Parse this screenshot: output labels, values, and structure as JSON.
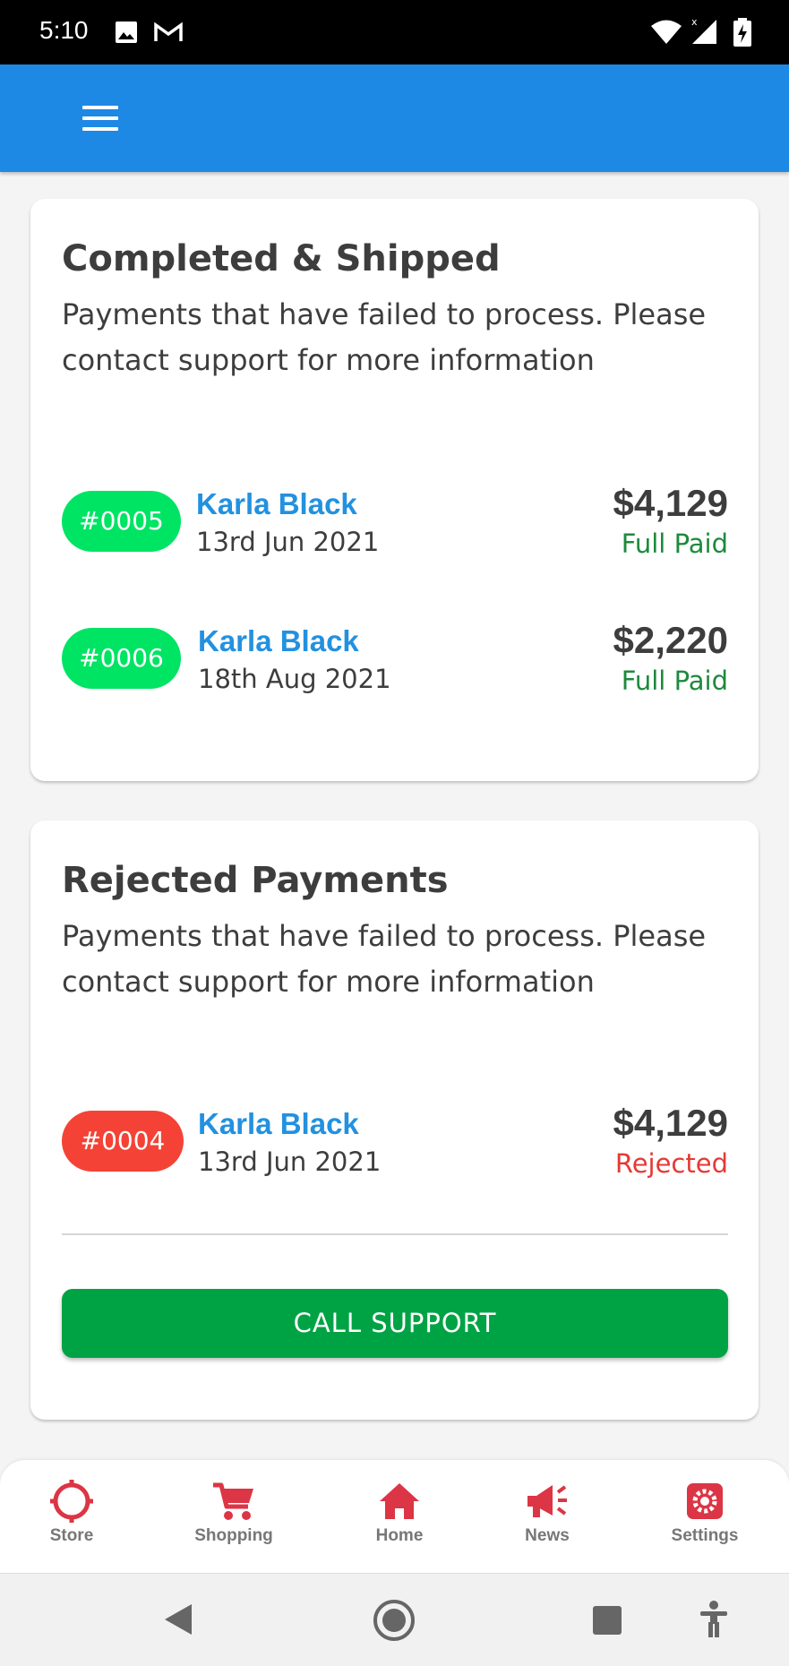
{
  "status_bar": {
    "time": "5:10",
    "left_icons": [
      "image-icon",
      "gmail-icon"
    ],
    "right_icons": [
      "wifi-icon",
      "signal-icon",
      "battery-charging-icon"
    ]
  },
  "app_bar": {
    "menu_icon": "hamburger-menu-icon",
    "color": "#1e88e5"
  },
  "sections": [
    {
      "title": "Completed & Shipped",
      "description": "Payments that have failed to process. Please contact support for more information",
      "orders": [
        {
          "id": "#0005",
          "customer": "Karla Black",
          "date": "13rd Jun 2021",
          "amount": "$4,129",
          "status": "Full Paid"
        },
        {
          "id": "#0006",
          "customer": "Karla Black",
          "date": "18th Aug 2021",
          "amount": "$2,220",
          "status": "Full Paid"
        }
      ]
    },
    {
      "title": "Rejected Payments",
      "description": "Payments that have failed to process. Please contact support for more information",
      "orders": [
        {
          "id": "#0004",
          "customer": "Karla Black",
          "date": "13rd Jun 2021",
          "amount": "$4,129",
          "status": "Rejected"
        }
      ],
      "button_label": "CALL SUPPORT"
    }
  ],
  "bottom_nav": [
    {
      "label": "Store",
      "icon": "crosshair-icon"
    },
    {
      "label": "Shopping",
      "icon": "cart-icon"
    },
    {
      "label": "Home",
      "icon": "home-icon"
    },
    {
      "label": "News",
      "icon": "megaphone-icon"
    },
    {
      "label": "Settings",
      "icon": "gear-icon"
    }
  ],
  "colors": {
    "accent": "#dc3545",
    "paid_badge": "#00e464",
    "rejected_badge": "#f44336",
    "support_button": "#00a344",
    "customer_link": "#2291e0"
  }
}
